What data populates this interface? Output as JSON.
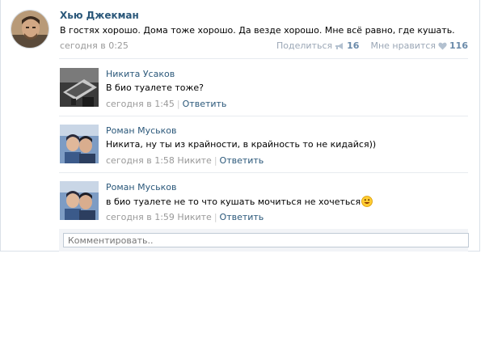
{
  "post": {
    "author": "Хью Джекман",
    "text": "В гостях хорошо. Дома тоже хорошо. Да везде хорошо. Мне всё равно, где кушать.",
    "date": "сегодня в 0:25",
    "share_label": "Поделиться",
    "share_count": "16",
    "like_label": "Мне нравится",
    "like_count": "116"
  },
  "comments": [
    {
      "author": "Никита Усаков",
      "text": "В био туалете тоже?",
      "date": "сегодня в 1:45",
      "reply_to": "",
      "answer_label": "Ответить"
    },
    {
      "author": "Роман Муськов",
      "text": "Никита, ну ты из крайности, в крайность то не кидайся))",
      "date": "сегодня в 1:58",
      "reply_to": "Никите",
      "answer_label": "Ответить"
    },
    {
      "author": "Роман Муськов",
      "text": "в био туалете не то что кушать мочиться не хочеться",
      "date": "сегодня в 1:59",
      "reply_to": "Никите",
      "answer_label": "Ответить",
      "emoji": "smiley-icon"
    }
  ],
  "comment_input": {
    "placeholder": "Комментировать.."
  },
  "colors": {
    "link": "#2b587a",
    "meta": "#999999",
    "separator": "#e7ebef"
  }
}
